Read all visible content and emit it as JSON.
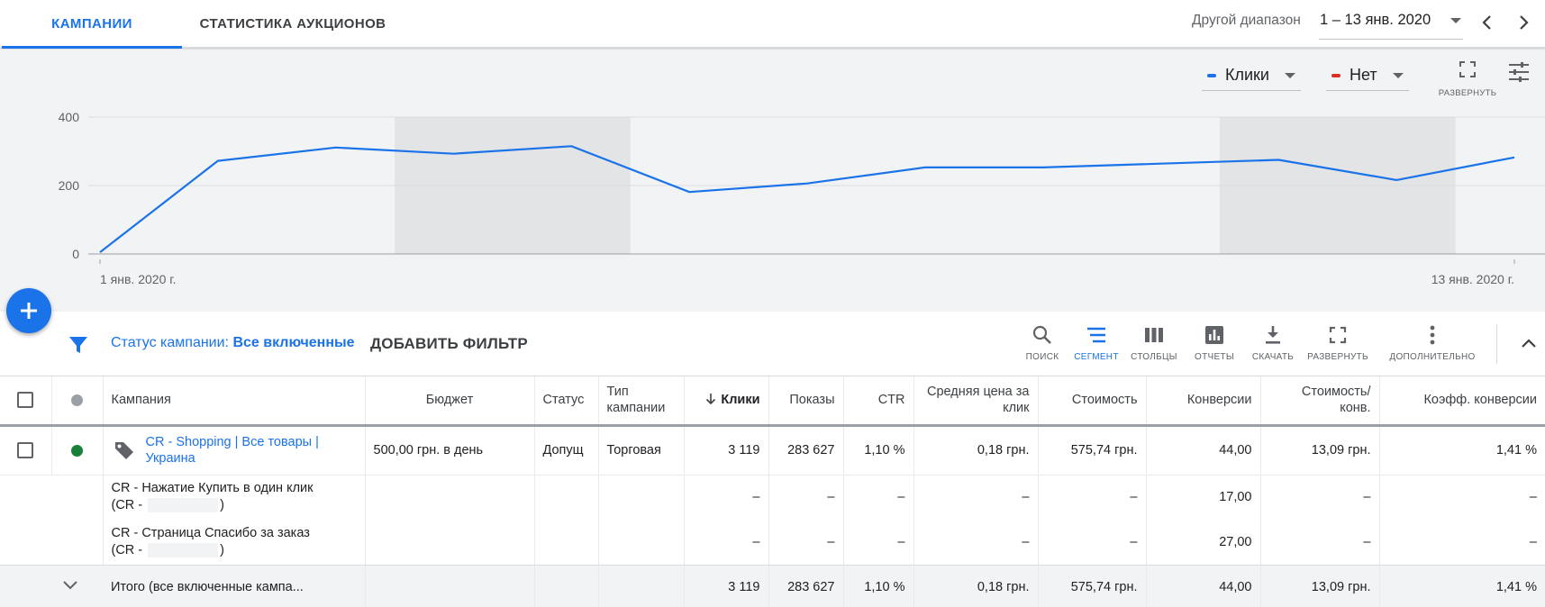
{
  "tabs": [
    {
      "label": "КАМПАНИИ",
      "active": true
    },
    {
      "label": "СТАТИСТИКА АУКЦИОНОВ",
      "active": false
    }
  ],
  "date_range": {
    "label": "Другой диапазон",
    "value": "1 – 13 янв. 2020"
  },
  "chart_controls": {
    "metric1": {
      "label": "Клики",
      "color": "#1a73e8"
    },
    "metric2": {
      "label": "Нет",
      "color": "#d93025"
    },
    "expand_label": "РАЗВЕРНУТЬ"
  },
  "chart_data": {
    "type": "line",
    "x": [
      "1 янв.",
      "2 янв.",
      "3 янв.",
      "4 янв.",
      "5 янв.",
      "6 янв.",
      "7 янв.",
      "8 янв.",
      "9 янв.",
      "10 янв.",
      "11 янв.",
      "12 янв.",
      "13 янв."
    ],
    "series": [
      {
        "name": "Клики",
        "color": "#1a73e8",
        "values": [
          5,
          272,
          311,
          293,
          315,
          181,
          206,
          253,
          253,
          264,
          275,
          216,
          282
        ]
      }
    ],
    "ylim": [
      0,
      400
    ],
    "yticks": [
      0,
      200,
      400
    ],
    "x_start_label": "1 янв. 2020 г.",
    "x_end_label": "13 янв. 2020 г.",
    "weekend_shading": [
      "4 янв.",
      "5 янв.",
      "11 янв.",
      "12 янв."
    ],
    "grid": true
  },
  "filter": {
    "label": "Статус кампании: ",
    "value": "Все включенные",
    "add_label": "ДОБАВИТЬ ФИЛЬТР"
  },
  "toolbar": {
    "search": "ПОИСК",
    "segment": "СЕГМЕНТ",
    "columns": "СТОЛБЦЫ",
    "reports": "ОТЧЕТЫ",
    "download": "СКАЧАТЬ",
    "expand": "РАЗВЕРНУТЬ",
    "more": "ДОПОЛНИТЕЛЬНО"
  },
  "table": {
    "headers": {
      "campaign": "Кампания",
      "budget": "Бюджет",
      "status": "Статус",
      "type": "Тип кампании",
      "clicks": "Клики",
      "impressions": "Показы",
      "ctr": "CTR",
      "avg_cpc": "Средняя цена за клик",
      "cost": "Стоимость",
      "conversions": "Конверсии",
      "cost_per_conv": "Стоимость/ конв.",
      "conv_rate": "Коэфф. конверсии"
    },
    "campaign_row": {
      "name": "CR - Shopping | Все товары | Украина",
      "status_color": "#188038",
      "budget": "500,00 грн. в день",
      "status": "Допущ",
      "type": "Торговая",
      "clicks": "3 119",
      "impressions": "283 627",
      "ctr": "1,10 %",
      "avg_cpc": "0,18 грн.",
      "cost": "575,74 грн.",
      "conversions": "44,00",
      "cost_per_conv": "13,09 грн.",
      "conv_rate": "1,41 %"
    },
    "conversion_rows": [
      {
        "name_line1": "CR - Нажатие Купить в один клик",
        "name_prefix": "(CR -",
        "name_suffix": ")",
        "clicks": "–",
        "impressions": "–",
        "ctr": "–",
        "avg_cpc": "–",
        "cost": "–",
        "conversions": "17,00",
        "cost_per_conv": "–",
        "conv_rate": "–"
      },
      {
        "name_line1": "CR - Страница Спасибо за заказ",
        "name_prefix": "(CR -",
        "name_suffix": ")",
        "clicks": "–",
        "impressions": "–",
        "ctr": "–",
        "avg_cpc": "–",
        "cost": "–",
        "conversions": "27,00",
        "cost_per_conv": "–",
        "conv_rate": "–"
      }
    ],
    "total_row": {
      "label": "Итого (все включенные кампа...",
      "clicks": "3 119",
      "impressions": "283 627",
      "ctr": "1,10 %",
      "avg_cpc": "0,18 грн.",
      "cost": "575,74 грн.",
      "conversions": "44,00",
      "cost_per_conv": "13,09 грн.",
      "conv_rate": "1,41 %"
    }
  }
}
